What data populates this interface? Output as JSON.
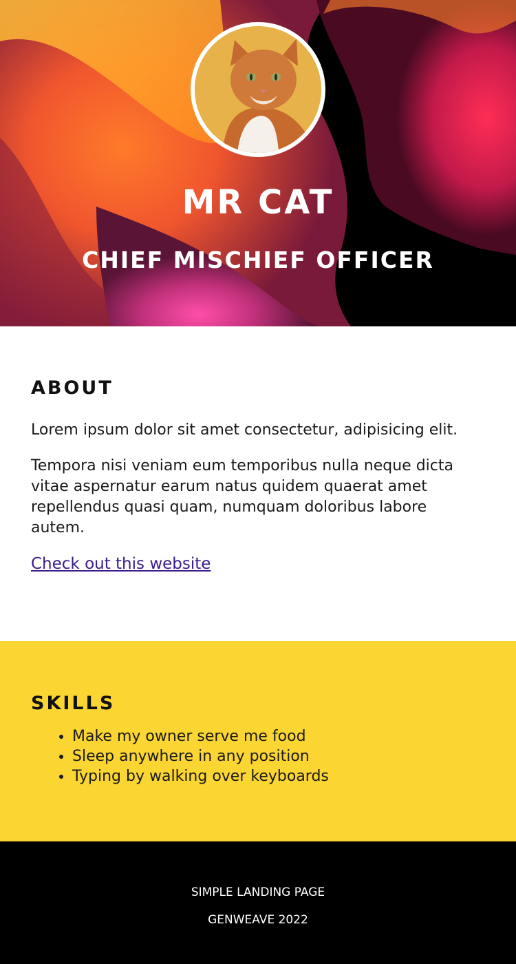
{
  "hero": {
    "name": "MR CAT",
    "role": "CHIEF MISCHIEF OFFICER",
    "avatar_icon": "cat-photo"
  },
  "about": {
    "title": "ABOUT",
    "paragraph_1": "Lorem ipsum dolor sit amet consectetur, adipisicing elit.",
    "paragraph_2": "Tempora nisi veniam eum temporibus nulla neque dicta vitae aspernatur earum natus quidem quaerat amet repellendus quasi quam, numquam doloribus labore autem.",
    "link_text": "Check out this website"
  },
  "skills": {
    "title": "SKILLS",
    "items": [
      "Make my owner serve me food",
      "Sleep anywhere in any position",
      "Typing by walking over keyboards"
    ]
  },
  "footer": {
    "line_1": "SIMPLE LANDING PAGE",
    "line_2": "GENWEAVE 2022"
  },
  "colors": {
    "skills_background": "#fbd531",
    "footer_background": "#000000",
    "link": "#3b1a8c"
  }
}
